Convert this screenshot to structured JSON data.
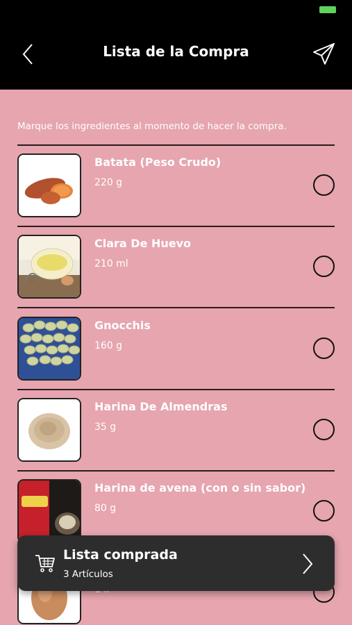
{
  "header": {
    "title": "Lista de la Compra"
  },
  "instructions": "Marque los ingredientes al momento de hacer la compra.",
  "items": [
    {
      "name": "Batata (Peso Crudo)",
      "quantity": "220 g",
      "image": "sweet-potato",
      "checked": false
    },
    {
      "name": "Clara De Huevo",
      "quantity": "210 ml",
      "image": "egg-white",
      "checked": false
    },
    {
      "name": "Gnocchis",
      "quantity": "160 g",
      "image": "gnocchi",
      "checked": false
    },
    {
      "name": "Harina De Almendras",
      "quantity": "35 g",
      "image": "almond-flour",
      "checked": false
    },
    {
      "name": "Harina de avena (con o sin sabor)",
      "quantity": "80 g",
      "image": "oat-flour",
      "checked": false
    },
    {
      "name": "",
      "quantity": "1 x",
      "image": "egg",
      "checked": false
    }
  ],
  "cart_toast": {
    "title": "Lista comprada",
    "subtitle": "3 Artículos"
  },
  "colors": {
    "background": "#e6a5af",
    "header": "#000000",
    "toast": "#2d2d2d"
  }
}
